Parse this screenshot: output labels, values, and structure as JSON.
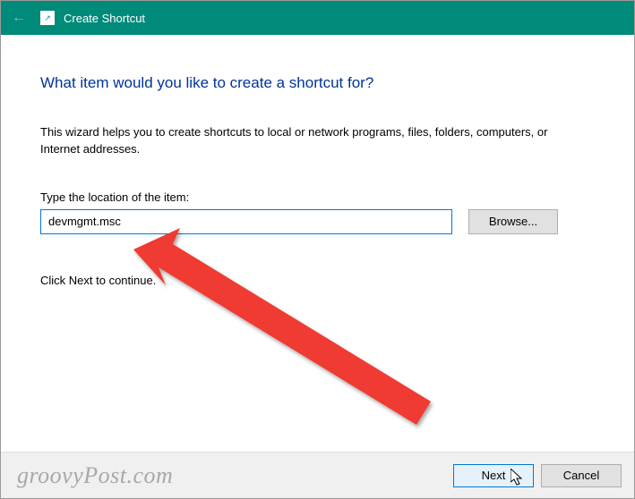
{
  "titlebar": {
    "title": "Create Shortcut"
  },
  "main": {
    "heading": "What item would you like to create a shortcut for?",
    "description": "This wizard helps you to create shortcuts to local or network programs, files, folders, computers, or Internet addresses.",
    "field_label": "Type the location of the item:",
    "location_value": "devmgmt.msc",
    "browse_label": "Browse...",
    "continue_text": "Click Next to continue."
  },
  "footer": {
    "next_label": "Next",
    "cancel_label": "Cancel"
  },
  "watermark": "groovyPost.com"
}
